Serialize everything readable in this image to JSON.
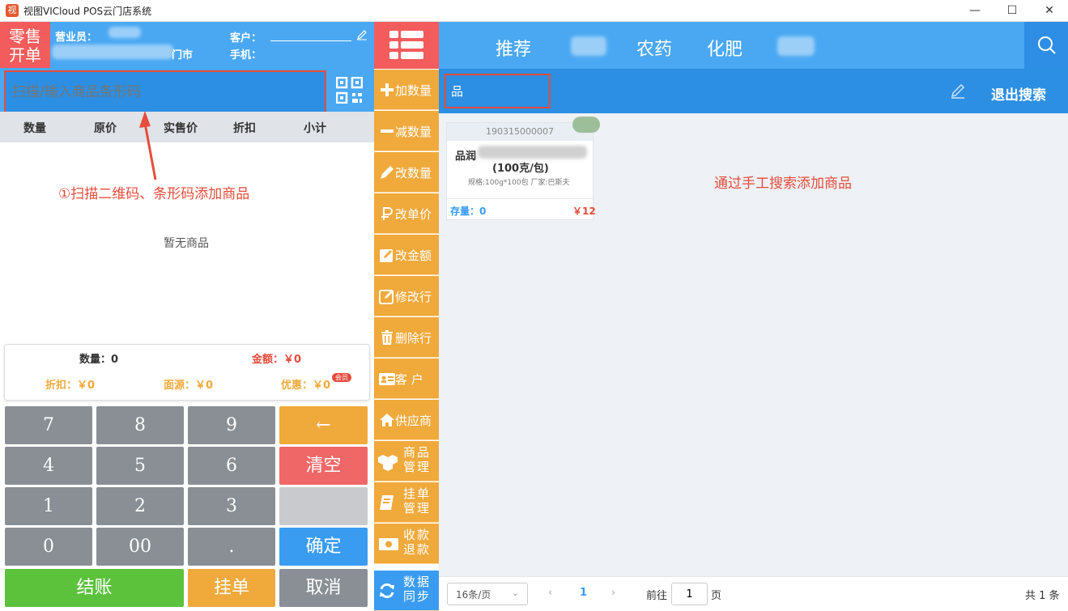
{
  "window": {
    "title": "视图VICloud POS云门店系统",
    "controls": {
      "minimize": "—",
      "maximize": "☐",
      "close": "✕"
    }
  },
  "left_header": {
    "mode_label_line1": "零售",
    "mode_label_line2": "开单",
    "salesperson_label": "营业员：",
    "store_suffix": "门市",
    "customer_label": "客户：",
    "phone_label": "手机："
  },
  "scan": {
    "placeholder": "扫描/输入商品条形码"
  },
  "cart_columns": [
    "数量",
    "原价",
    "实售价",
    "折扣",
    "小计"
  ],
  "annotations": {
    "scan_note": "①扫描二维码、条形码添加商品",
    "search_note": "通过手工搜索添加商品"
  },
  "cart_empty_text": "暂无商品",
  "summary": {
    "qty": "数量：0",
    "amount": "金额：￥0",
    "discount": "折扣：￥0",
    "face": "面源：￥0",
    "promo": "优惠：￥0",
    "member_badge": "会员"
  },
  "keypad": {
    "k7": "7",
    "k8": "8",
    "k9": "9",
    "back": "←",
    "k4": "4",
    "k5": "5",
    "k6": "6",
    "clear": "清空",
    "k1": "1",
    "k2": "2",
    "k3": "3",
    "k0": "0",
    "k00": "00",
    "dot": ".",
    "confirm": "确定",
    "checkout": "结账",
    "hold": "挂单",
    "cancel": "取消"
  },
  "side_menu": {
    "add_qty": "加数量",
    "sub_qty": "减数量",
    "edit_qty": "改数量",
    "edit_price": "改单价",
    "edit_amount": "改金额",
    "edit_row": "修改行",
    "delete_row": "删除行",
    "customer": "客 户",
    "supplier": "供应商",
    "goods_mgmt": "商品管理",
    "hold_mgmt": "挂单管理",
    "refund": "收款退款",
    "sync": "数据同步"
  },
  "category_tabs": [
    "推荐",
    "农药",
    "化肥"
  ],
  "search": {
    "value": "品",
    "exit_label": "退出搜索"
  },
  "product_card": {
    "code": "190315000007",
    "name_prefix": "品润",
    "name_suffix": "(100克/包)",
    "spec": "规格:100g*100包 厂家:巴斯夫",
    "stock": "存量：0",
    "price": "￥12"
  },
  "pager": {
    "page_size": "16条/页",
    "current_page": "1",
    "goto_label": "前往",
    "goto_value": "1",
    "page_unit": "页",
    "total": "共 1 条"
  },
  "colors": {
    "blue": "#4aa8f2",
    "dark_blue": "#2d8fe3",
    "orange": "#f0a93b",
    "red": "#f25c5c",
    "green": "#5cc23c"
  }
}
